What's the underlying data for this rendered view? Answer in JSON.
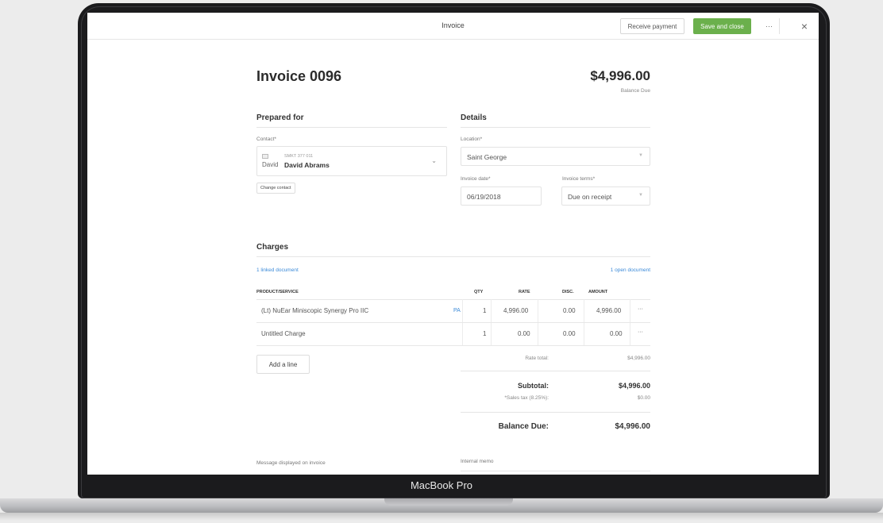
{
  "device": {
    "label": "MacBook Pro"
  },
  "header": {
    "title": "Invoice",
    "receive_payment": "Receive payment",
    "save_close": "Save and close",
    "more": "···",
    "close": "×"
  },
  "invoice": {
    "title": "Invoice 0096",
    "balance": "$4,996.00",
    "balance_label": "Balance Due"
  },
  "prepared_for": {
    "heading": "Prepared for",
    "contact_label": "Contact*",
    "avatar_alt": "David",
    "contact_id": "SMKT 377 011",
    "contact_name": "David Abrams",
    "change_contact": "Change contact"
  },
  "details": {
    "heading": "Details",
    "location_label": "Location*",
    "location": "Saint George",
    "date_label": "Invoice date*",
    "date": "06/19/2018",
    "terms_label": "Invoice terms*",
    "terms": "Due on receipt"
  },
  "charges": {
    "heading": "Charges",
    "linked": "1 linked document",
    "open": "1 open document",
    "columns": {
      "product": "PRODUCT/SERVICE",
      "qty": "QTY",
      "rate": "RATE",
      "disc": "DISC.",
      "amount": "AMOUNT"
    },
    "rows": [
      {
        "product": "(Lt) NuEar Miniscopic Synergy Pro IIC",
        "tag": "PA",
        "qty": "1",
        "rate": "4,996.00",
        "disc": "0.00",
        "amount": "4,996.00",
        "menu": "···"
      },
      {
        "product": "Untitled Charge",
        "tag": "",
        "qty": "1",
        "rate": "0.00",
        "disc": "0.00",
        "amount": "0.00",
        "menu": "···"
      }
    ],
    "add_line": "Add a line"
  },
  "totals": {
    "rate_total_label": "Rate total:",
    "rate_total": "$4,996.00",
    "subtotal_label": "Subtotal:",
    "subtotal": "$4,996.00",
    "tax_label": "*Sales tax (8.25%):",
    "tax": "$0.00",
    "balance_label": "Balance Due:",
    "balance": "$4,996.00"
  },
  "footer": {
    "message_label": "Message displayed on invoice",
    "memo_label": "Internal memo"
  },
  "colors": {
    "accent": "#6bb04c",
    "link": "#3b8ad8"
  }
}
